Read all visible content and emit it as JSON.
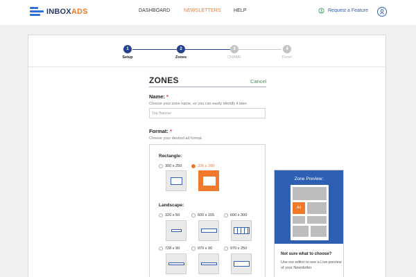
{
  "brand": {
    "name_main": "INBOX",
    "name_accent": "ADS"
  },
  "nav": {
    "dashboard": "DASHBOARD",
    "newsletters": "NEWSLETTERS",
    "help": "HELP"
  },
  "header": {
    "request_feature": "Request a Feature"
  },
  "steps": [
    {
      "number": "1",
      "label": "Setup",
      "state": "done"
    },
    {
      "number": "2",
      "label": "Zones",
      "state": "current"
    },
    {
      "number": "3",
      "label": "CNAME",
      "state": "pending"
    },
    {
      "number": "4",
      "label": "Done!",
      "state": "pending"
    }
  ],
  "form": {
    "title": "ZONES",
    "cancel": "Cancel",
    "name_label": "Name:",
    "name_help": "Choose your zone name, so you can easily identify it later.",
    "name_placeholder": "Top Banner",
    "format_label": "Format:",
    "format_help": "Choose your desired ad format.",
    "required_mark": "*"
  },
  "formats": {
    "rectangle_label": "Rectangle:",
    "landscape_label": "Landscape:",
    "rectangle": [
      {
        "label": "300 x 250",
        "selected": false
      },
      {
        "label": "336 x 280",
        "selected": true
      }
    ],
    "landscape": [
      {
        "label": "320 x 50",
        "selected": false
      },
      {
        "label": "600 x 155",
        "selected": false
      },
      {
        "label": "600 x 300",
        "selected": false
      },
      {
        "label": "728 x 90",
        "selected": false
      },
      {
        "label": "970 x 90",
        "selected": false
      },
      {
        "label": "970 x 250",
        "selected": false
      }
    ]
  },
  "preview": {
    "title": "Zone Preview:",
    "ad_label": "Ad",
    "question": "Not sure what to choose?",
    "description": "Use our editor to see a Live preview of your Newsletter."
  },
  "colors": {
    "accent": "#f07a2a",
    "primary": "#2f5fb3",
    "step_active": "#24418f",
    "cancel": "#3a9b52"
  },
  "icons": [
    "logo-icon",
    "lightbulb-icon",
    "user-avatar-icon"
  ]
}
